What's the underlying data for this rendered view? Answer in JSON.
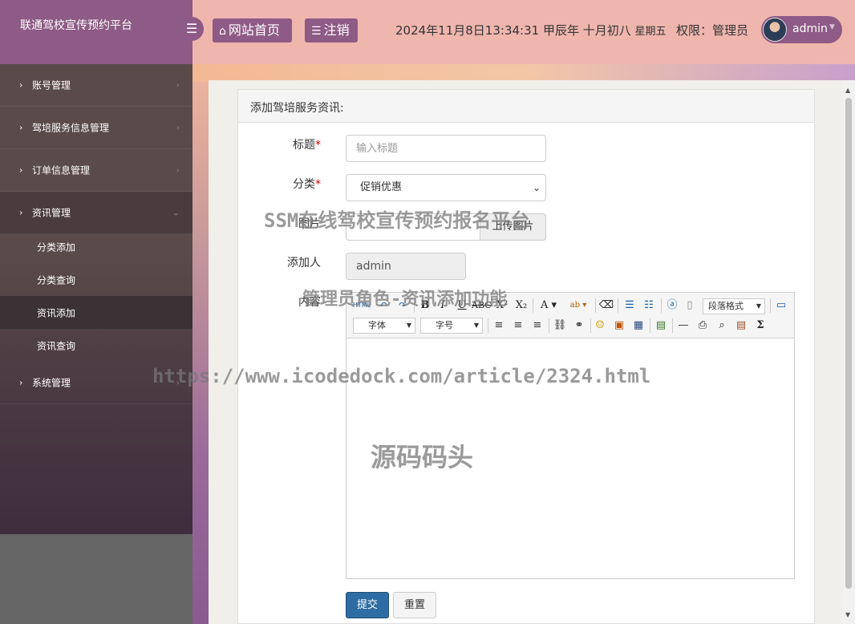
{
  "brand": {
    "title": "联通驾校宣传预约平台"
  },
  "sidebar": {
    "items": [
      {
        "label": "账号管理",
        "arrow": "›"
      },
      {
        "label": "驾培服务信息管理",
        "arrow": "›"
      },
      {
        "label": "订单信息管理",
        "arrow": "›"
      },
      {
        "label": "资讯管理",
        "arrow": "⌄"
      },
      {
        "label": "系统管理",
        "arrow": "›"
      }
    ],
    "subitems": [
      {
        "label": "分类添加"
      },
      {
        "label": "分类查询"
      },
      {
        "label": "资讯添加"
      },
      {
        "label": "资讯查询"
      }
    ]
  },
  "header": {
    "home_label": "网站首页",
    "logout_label": "注销",
    "datetime": "2024年11月8日13:34:31 甲辰年 十月初八",
    "weekday": "星期五",
    "permission": "权限：管理员",
    "username": "admin"
  },
  "form": {
    "card_title": "添加驾培服务资讯:",
    "title_label": "标题",
    "title_placeholder": "输入标题",
    "category_label": "分类",
    "category_value": "促销优惠",
    "image_label": "图片",
    "upload_label": "上传图片",
    "adder_label": "添加人",
    "adder_value": "admin",
    "content_label": "内容",
    "toolbar": {
      "html": "HTML",
      "paragraph": "段落格式",
      "font": "字体",
      "size": "字号"
    },
    "submit_label": "提交",
    "reset_label": "重置"
  },
  "watermarks": {
    "w1": "SSM在线驾校宣传预约报名平台",
    "w2": "管理员角色-资讯添加功能",
    "w3": "https://www.icodedock.com/article/2324.html",
    "w4": "源码码头"
  }
}
